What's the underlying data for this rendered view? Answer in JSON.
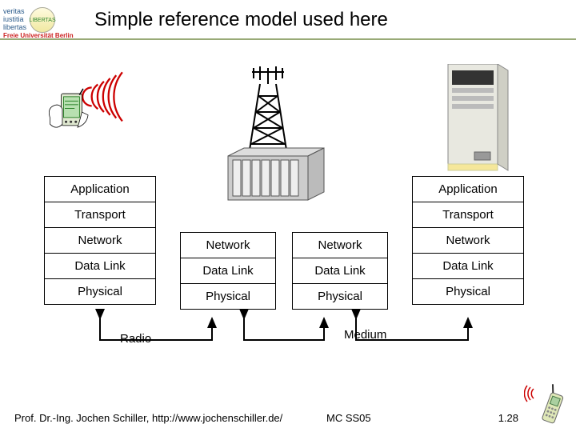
{
  "header": {
    "motto1": "veritas",
    "motto2": "iustitia",
    "motto3": "libertas",
    "seal": "LIBERTAS",
    "university": "Freie Universität Berlin",
    "title": "Simple reference model used here"
  },
  "layers": {
    "application": "Application",
    "transport": "Transport",
    "network": "Network",
    "datalink": "Data Link",
    "physical": "Physical"
  },
  "labels": {
    "radio": "Radio",
    "medium": "Medium"
  },
  "footer": {
    "author": "Prof. Dr.-Ing. Jochen Schiller, http://www.jochenschiller.de/",
    "course": "MC SS05",
    "slide": "1.28"
  }
}
